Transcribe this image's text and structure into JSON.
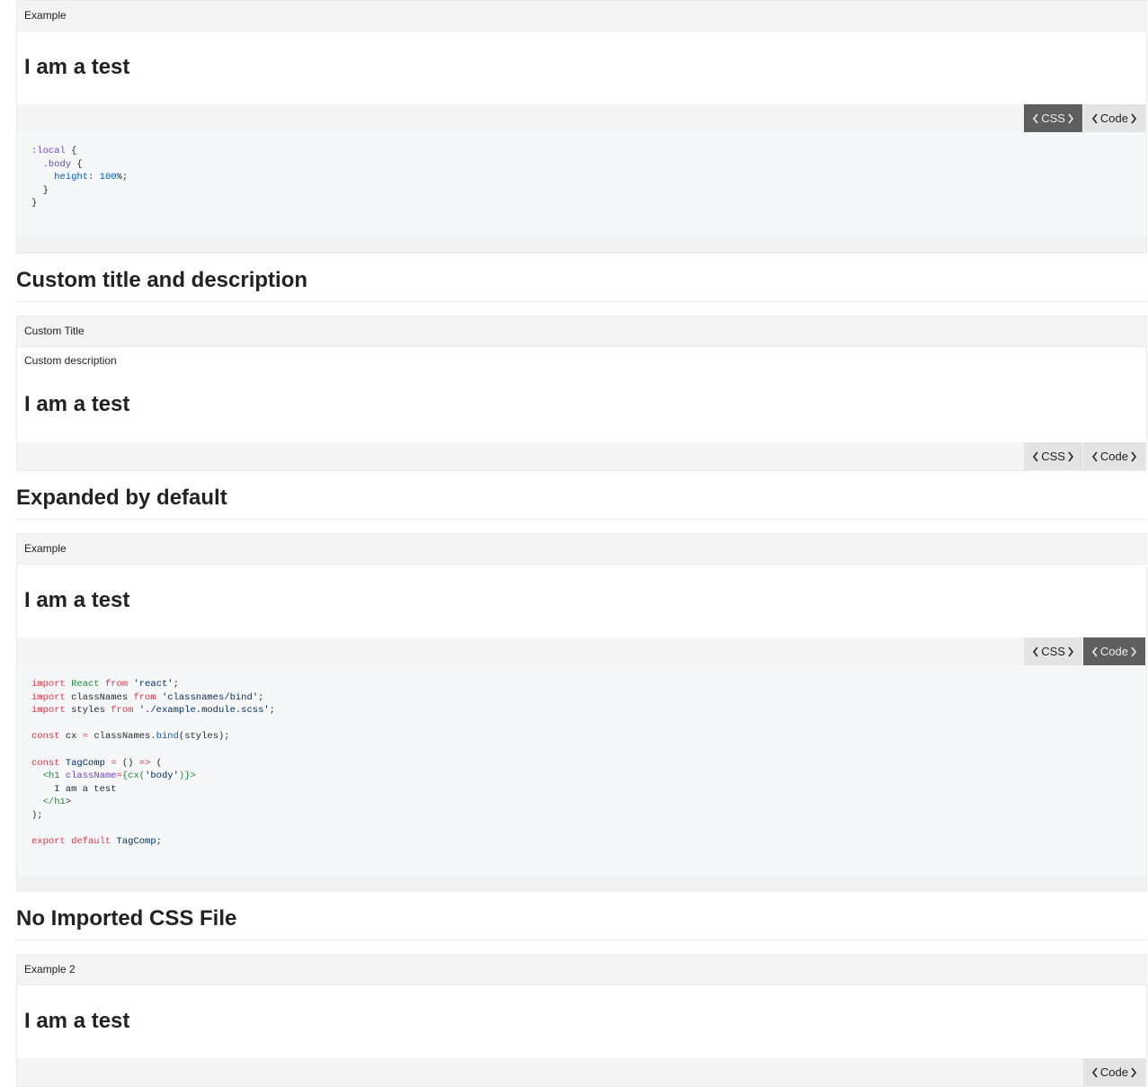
{
  "sections": {
    "s1_title": "",
    "s2_title": "Custom title and description",
    "s3_title": "Expanded by default",
    "s4_title": "No Imported CSS File"
  },
  "examples": [
    {
      "label": "Example",
      "heading": "I am a test",
      "css_label": "CSS",
      "code_label": "Code"
    },
    {
      "label": "Custom Title",
      "description": "Custom description",
      "heading": "I am a test",
      "css_label": "CSS",
      "code_label": "Code"
    },
    {
      "label": "Example",
      "heading": "I am a test",
      "css_label": "CSS",
      "code_label": "Code"
    },
    {
      "label": "Example 2",
      "heading": "I am a test",
      "code_label": "Code"
    }
  ],
  "css_code": [
    ":local {",
    "  .body {",
    "    height: 100%;",
    "  }",
    "}"
  ],
  "js_code": [
    "import React from 'react';",
    "import classNames from 'classnames/bind';",
    "import styles from './example.module.scss';",
    "",
    "const cx = classNames.bind(styles);",
    "",
    "const TagComp = () => (",
    "  <h1 className={cx('body')}>",
    "    I am a test",
    "  </h1>",
    ");",
    "",
    "export default TagComp;"
  ],
  "colors": {
    "active_button": "#5f5f5f",
    "button": "#e4e4e4",
    "header_bg": "#f4f4f4",
    "code_bg": "#f6f7f9"
  }
}
